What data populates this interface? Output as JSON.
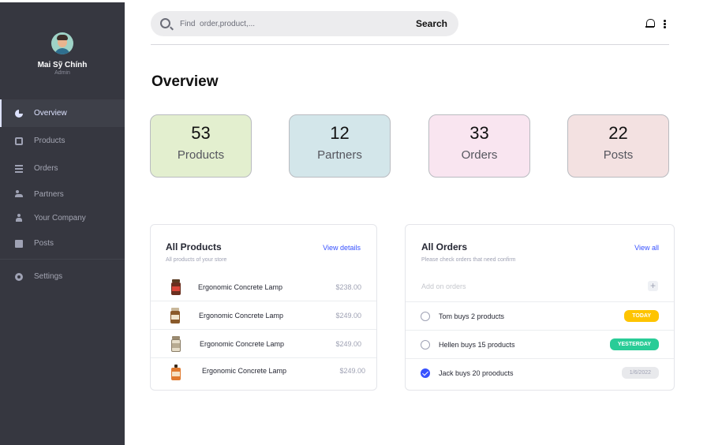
{
  "profile": {
    "name": "Mai Sỹ Chính",
    "role": "Admin"
  },
  "sidebar": {
    "items": [
      {
        "label": "Overview",
        "icon": "pie-chart-icon",
        "active": true
      },
      {
        "label": "Products",
        "icon": "ticket-icon"
      },
      {
        "label": "Orders",
        "icon": "list-icon"
      },
      {
        "label": "Partners",
        "icon": "users-icon"
      },
      {
        "label": "Your Company",
        "icon": "person-icon"
      },
      {
        "label": "Posts",
        "icon": "document-icon"
      }
    ],
    "settings": {
      "label": "Settings",
      "icon": "gear-icon"
    }
  },
  "header": {
    "search_placeholder": "Find  order,product,...",
    "search_button": "Search"
  },
  "page": {
    "title": "Overview"
  },
  "stats": [
    {
      "value": "53",
      "label": "Products",
      "color": "#e3efcf"
    },
    {
      "value": "12",
      "label": "Partners",
      "color": "#d3e6ea"
    },
    {
      "value": "33",
      "label": "Orders",
      "color": "#f9e5f0"
    },
    {
      "value": "22",
      "label": "Posts",
      "color": "#f3e1e1"
    }
  ],
  "products_panel": {
    "title": "All Products",
    "subtitle": "All products of your store",
    "link": "View details",
    "items": [
      {
        "name": "Ergonomic Concrete Lamp",
        "price": "$238.00"
      },
      {
        "name": "Ergonomic Concrete Lamp",
        "price": "$249.00"
      },
      {
        "name": "Ergonomic Concrete Lamp",
        "price": "$249.00"
      },
      {
        "name": "Ergonomic Concrete Lamp",
        "price": "$249.00"
      }
    ]
  },
  "orders_panel": {
    "title": "All Orders",
    "subtitle": "Please check orders that need confirm",
    "link": "View all",
    "add_placeholder": "Add on orders",
    "add_button": "+",
    "items": [
      {
        "text": "Tom buys 2 products",
        "badge": "TODAY",
        "checked": false
      },
      {
        "text": "Hellen buys 15 products",
        "badge": "YESTERDAY",
        "checked": false
      },
      {
        "text": "Jack buys 20 prooducts",
        "badge": "1/6/2022",
        "checked": true
      }
    ]
  }
}
